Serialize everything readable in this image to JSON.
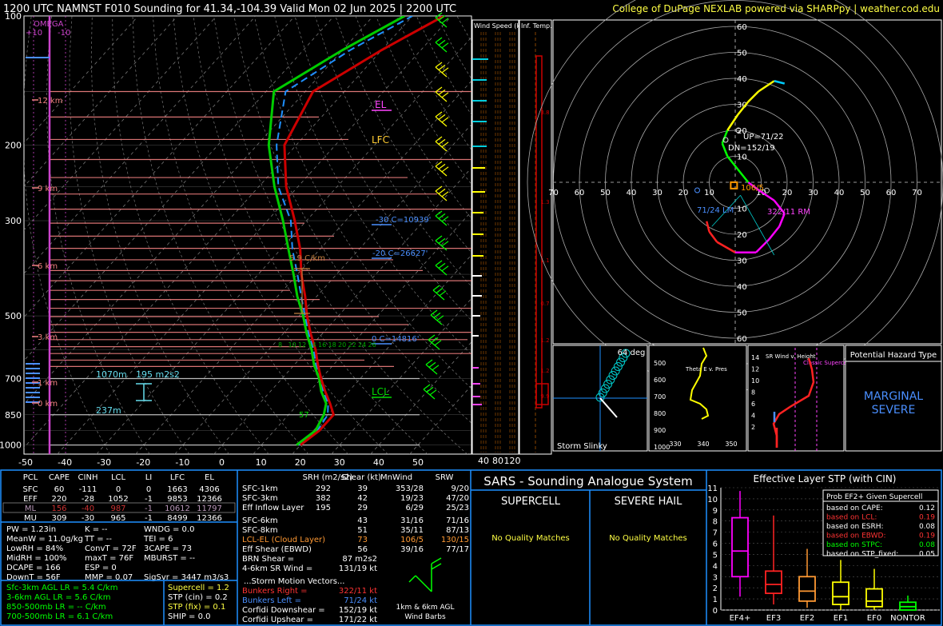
{
  "header": {
    "title": "1200 UTC NAMNST F010 Sounding for 41.34,-104.39 Valid  Mon 02 Jun 2025 | 2200 UTC",
    "credit": "College of DuPage NEXLAB powered via SHARPpy | weather.cod.edu"
  },
  "colors": {
    "temp": "#cc0000",
    "dewpoint": "#00cc00",
    "wetbulb": "#1e90ff",
    "accent": "#ffff44",
    "panel_border": "#1e90ff"
  },
  "skewt": {
    "omega_label": "OMEGA",
    "omega_ticks": [
      "+10",
      "-10"
    ],
    "pressure_ticks": [
      "100",
      "200",
      "300",
      "500",
      "700",
      "850",
      "1000"
    ],
    "temp_ticks": [
      "-50",
      "-40",
      "-30",
      "-20",
      "-10",
      "0",
      "10",
      "20",
      "30",
      "40",
      "50"
    ],
    "height_labels": [
      "12 km",
      "9 km",
      "6 km",
      "3 km",
      "1 km",
      "0 km"
    ],
    "parcel_labels": {
      "el": "EL",
      "lfc": "LFC",
      "lcl": "LCL"
    },
    "annotations": [
      "-30 C=10939'",
      "-20 C=26627'",
      "0 C=14816'",
      "5.9 C/km",
      "1070m",
      "195 m2s2",
      "237m",
      "57"
    ],
    "wetbulb_ticks": [
      "8",
      "10",
      "12",
      "14",
      "16",
      "18",
      "20",
      "22",
      "24",
      "26"
    ],
    "profiles": {
      "pressure": [
        1000,
        925,
        850,
        800,
        750,
        700,
        650,
        600,
        550,
        500,
        450,
        400,
        350,
        300,
        250,
        200,
        150,
        120,
        100
      ],
      "temp": [
        20,
        21.5,
        21.5,
        18,
        14,
        10,
        6,
        2,
        -3,
        -8,
        -13,
        -19,
        -25,
        -33,
        -43,
        -53,
        -58,
        -50,
        -42
      ],
      "dewpoint": [
        19,
        20.5,
        19,
        17,
        13,
        9.5,
        5,
        1,
        -4,
        -9,
        -15,
        -21,
        -28,
        -36,
        -46,
        -57,
        -68,
        -60,
        -52
      ],
      "wetbulb": [
        19.5,
        21,
        20,
        17.5,
        13.5,
        9.7,
        5.5,
        1.5,
        -3.5,
        -8.5,
        -14,
        -20,
        -27,
        -34,
        -45,
        -55,
        -65,
        -58,
        -50
      ]
    },
    "wind_barbs_label": "Wind Speed (knots)"
  },
  "wind_speed_panel": {
    "label": "Wind Speed (knots)",
    "ticks": [
      "40",
      "80",
      "120"
    ]
  },
  "inf_temp_panel": {
    "label": "Inf. Temp. Adv. (C/hr)",
    "values": [
      "3.8",
      "1.3",
      "1.1",
      "0.7",
      "1.2",
      "1.2",
      "9.9"
    ]
  },
  "hodograph": {
    "rings": [
      "10",
      "20",
      "30",
      "40",
      "50",
      "60"
    ],
    "x_labels": [
      "70",
      "60",
      "50",
      "40",
      "30",
      "20",
      "10",
      "10",
      "20",
      "30",
      "40",
      "50",
      "60",
      "70"
    ],
    "labels": {
      "up": "UP=71/22",
      "dn": "DN=152/19",
      "mean": "106/5",
      "lm": "71/24 LM",
      "rm": "322/11 RM"
    },
    "points": [
      [
        -18,
        -15
      ],
      [
        -16,
        -20
      ],
      [
        -12,
        -26
      ],
      [
        -2,
        -27
      ],
      [
        6,
        -28
      ],
      [
        10,
        -29
      ],
      [
        14,
        -25
      ],
      [
        19,
        -22
      ],
      [
        24,
        -16
      ],
      [
        25,
        -12
      ],
      [
        22,
        -7
      ],
      [
        18,
        -3
      ],
      [
        12,
        0
      ],
      [
        4,
        3
      ],
      [
        -4,
        10
      ],
      [
        -8,
        16
      ],
      [
        -11,
        24
      ],
      [
        -10,
        30
      ],
      [
        -6,
        34
      ],
      [
        2,
        37
      ],
      [
        10,
        38
      ],
      [
        16,
        37
      ]
    ]
  },
  "slinky": {
    "label": "Storm Slinky",
    "angle": "64 deg"
  },
  "theta_e": {
    "label": "Theta E v. Pres",
    "y_ticks": [
      "500",
      "600",
      "700",
      "800",
      "900",
      "1000"
    ],
    "x_ticks": [
      "330",
      "340",
      "350"
    ]
  },
  "sr_wind": {
    "label": "SR Wind v. Height",
    "note": "Classic Supercell",
    "y_ticks": [
      "14",
      "12",
      "10",
      "8",
      "6",
      "4",
      "2"
    ]
  },
  "hazard": {
    "title": "Potential Hazard Type",
    "value": "MARGINAL SEVERE"
  },
  "parcel_table": {
    "headers": [
      "PCL",
      "CAPE",
      "CINH",
      "LCL",
      "LI",
      "LFC",
      "EL"
    ],
    "rows": [
      [
        "SFC",
        "60",
        "-111",
        "0",
        "0",
        "1663",
        "4306"
      ],
      [
        "EFF",
        "220",
        "-28",
        "1052",
        "-1",
        "9853",
        "12366"
      ],
      [
        "ML",
        "156",
        "-40",
        "987",
        "-1",
        "10612",
        "11797"
      ],
      [
        "MU",
        "309",
        "-30",
        "965",
        "-1",
        "8499",
        "12366"
      ]
    ]
  },
  "indices": {
    "col1": [
      "PW = 1.23in",
      "MeanW = 11.0g/kg",
      "LowRH = 84%",
      "MidRH = 100%",
      "DCAPE = 166",
      "DownT = 56F"
    ],
    "col2": [
      "K = --",
      "TT = --",
      "ConvT = 72F",
      "maxT = 76F",
      "ESP = 0",
      "MMP = 0.07"
    ],
    "col3": [
      "WNDG = 0.0",
      "TEI = 6",
      "3CAPE = 73",
      "MBURST = --",
      "",
      "SigSvr = 3447 m3/s3"
    ]
  },
  "lapse_rates": [
    "Sfc-3km AGL LR = 5.4 C/km",
    "3-6km AGL LR = 5.6 C/km",
    "850-500mb LR = -- C/km",
    "700-500mb LR = 6.1 C/km"
  ],
  "composites": [
    "Supercell = 1.2",
    "STP (cin) = 0.2",
    "STP (fix) = 0.1",
    "SHIP = 0.0"
  ],
  "kinematics": {
    "headers": [
      "SRH (m2/s2)",
      "Shear (kt)",
      "MnWind",
      "SRW"
    ],
    "rows": [
      [
        "SFC-1km",
        "292",
        "39",
        "353/28",
        "9/20"
      ],
      [
        "SFC-3km",
        "382",
        "42",
        "19/23",
        "47/20"
      ],
      [
        "Eff Inflow Layer",
        "195",
        "29",
        "6/29",
        "25/23"
      ],
      [
        "SFC-6km",
        "43",
        "31/16",
        "71/16",
        ""
      ],
      [
        "SFC-8km",
        "51",
        "35/11",
        "87/13",
        ""
      ],
      [
        "LCL-EL (Cloud Layer)",
        "73",
        "106/5",
        "130/15",
        ""
      ],
      [
        "Eff Shear (EBWD)",
        "56",
        "39/16",
        "77/17",
        ""
      ]
    ],
    "brn": "BRN Shear =",
    "brn_val": "87 m2s2",
    "sr46": "4-6km SR Wind =",
    "sr46_val": "131/19 kt",
    "storm_motion_title": "...Storm Motion Vectors...",
    "bunkers_right": "Bunkers Right =",
    "bunkers_right_val": "322/11 kt",
    "bunkers_left": "Bunkers Left =",
    "bunkers_left_val": "71/24 kt",
    "corfidi_down": "Corfidi Downshear =",
    "corfidi_down_val": "152/19 kt",
    "corfidi_up": "Corfidi Upshear =",
    "corfidi_up_val": "171/22 kt",
    "barb_label": "1km & 6km AGL Wind Barbs"
  },
  "sars": {
    "title": "SARS - Sounding Analogue System",
    "supercell": "SUPERCELL",
    "hail": "SEVERE HAIL",
    "supercell_result": "No Quality Matches",
    "hail_result": "No Quality Matches"
  },
  "stp": {
    "title": "Effective Layer STP (with CIN)",
    "y_ticks": [
      "0",
      "1",
      "2",
      "3",
      "4",
      "5",
      "6",
      "7",
      "8",
      "9",
      "10",
      "11"
    ],
    "legend_title": "Prob EF2+ Given Supercell",
    "legend": [
      {
        "label": "based on CAPE:",
        "value": "0.12",
        "color": "#ffffff"
      },
      {
        "label": "based on LCL:",
        "value": "0.19",
        "color": "#ff3333"
      },
      {
        "label": "based on ESRH:",
        "value": "0.08",
        "color": "#ffffff"
      },
      {
        "label": "based on EBWD:",
        "value": "0.19",
        "color": "#ff3333"
      },
      {
        "label": "based on STPC:",
        "value": "0.08",
        "color": "#00ff00"
      },
      {
        "label": "based on STP_fixed:",
        "value": "0.05",
        "color": "#ffffff"
      }
    ],
    "boxes": [
      {
        "name": "EF4+",
        "color": "#ff00ff",
        "min": 1.2,
        "q1": 3.0,
        "med": 5.3,
        "q3": 8.3,
        "max": 10.7
      },
      {
        "name": "EF3",
        "color": "#ff2222",
        "min": 0.5,
        "q1": 1.5,
        "med": 2.3,
        "q3": 3.5,
        "max": 8.5
      },
      {
        "name": "EF2",
        "color": "#ff9933",
        "min": 0.2,
        "q1": 0.8,
        "med": 1.7,
        "q3": 3.0,
        "max": 5.5
      },
      {
        "name": "EF1",
        "color": "#ffff00",
        "min": 0.0,
        "q1": 0.5,
        "med": 1.2,
        "q3": 2.5,
        "max": 4.5
      },
      {
        "name": "EF0",
        "color": "#ffff00",
        "min": 0.0,
        "q1": 0.3,
        "med": 0.8,
        "q3": 1.9,
        "max": 3.7
      },
      {
        "name": "NONTOR",
        "color": "#00ff00",
        "min": 0.0,
        "q1": 0.0,
        "med": 0.3,
        "q3": 0.7,
        "max": 1.3
      }
    ]
  },
  "chart_data": {
    "type": "line",
    "title": "1200 UTC NAMNST F010 Sounding for 41.34,-104.39 Valid  Mon 02 Jun 2025 | 2200 UTC",
    "xlabel": "",
    "ylabel": "",
    "pressure": [
      1000,
      925,
      850,
      800,
      750,
      700,
      650,
      600,
      550,
      500,
      450,
      400,
      350,
      300,
      250,
      200,
      150,
      120,
      100
    ],
    "series": [
      {
        "values": [
          20,
          21.5,
          21.5,
          18,
          14,
          10,
          6,
          2,
          -3,
          -8,
          -13,
          -19,
          -25,
          -33,
          -43,
          -53,
          -58,
          -50,
          -42
        ]
      },
      {
        "values": [
          19,
          20.5,
          19,
          17,
          13,
          9.5,
          5,
          1,
          -4,
          -9,
          -15,
          -21,
          -28,
          -36,
          -46,
          -57,
          -68,
          -60,
          -52
        ]
      }
    ],
    "xlim": [
      -50,
      50
    ],
    "ylim": [
      1000,
      100
    ],
    "grid": true
  }
}
